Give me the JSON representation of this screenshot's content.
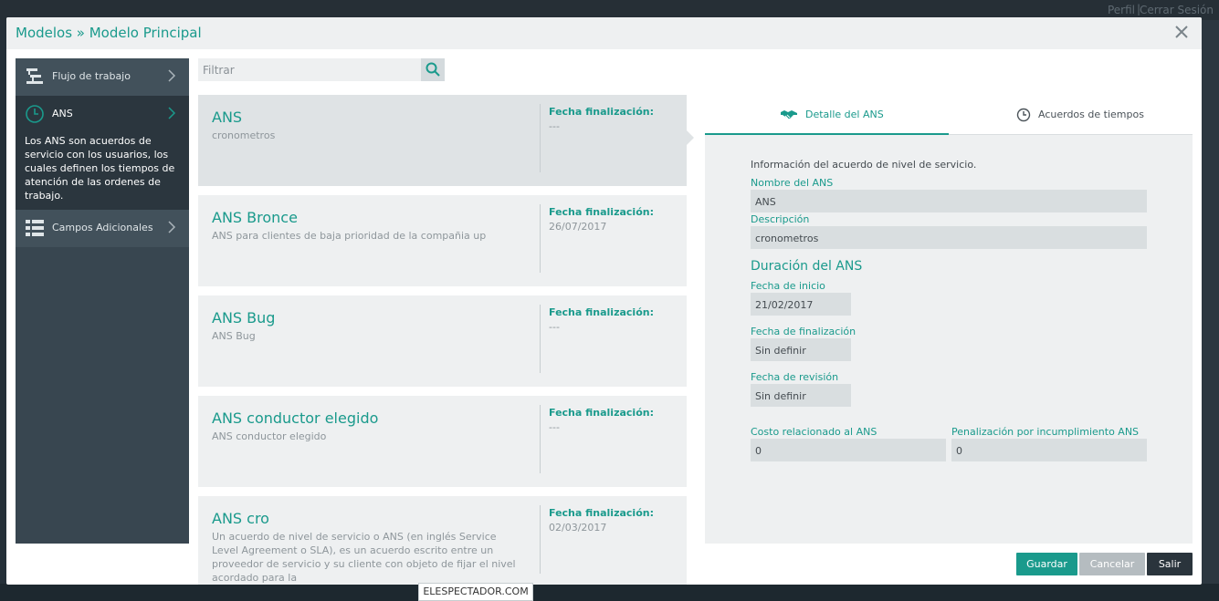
{
  "background": {
    "profile_label": "Perfil",
    "logout_label": "Cerrar Sesión"
  },
  "modal": {
    "title": "Modelos » Modelo Principal"
  },
  "sidebar": {
    "items": [
      {
        "label": "Flujo de trabajo",
        "icon": "workflow-icon"
      },
      {
        "label": "ANS",
        "icon": "clock-icon",
        "description": "Los ANS son acuerdos de servicio con los usuarios, los cuales definen los tiempos de atención de las ordenes de trabajo."
      },
      {
        "label": "Campos Adicionales",
        "icon": "list-icon"
      }
    ]
  },
  "filter": {
    "placeholder": "Filtrar"
  },
  "cards": [
    {
      "title": "ANS",
      "description": "cronometros",
      "date_label": "Fecha finalización:",
      "date": "---"
    },
    {
      "title": "ANS Bronce",
      "description": "ANS para clientes de baja prioridad de la compañia up",
      "date_label": "Fecha finalización:",
      "date": "26/07/2017"
    },
    {
      "title": "ANS Bug",
      "description": "ANS Bug",
      "date_label": "Fecha finalización:",
      "date": "---"
    },
    {
      "title": "ANS conductor elegido",
      "description": "ANS conductor elegido",
      "date_label": "Fecha finalización:",
      "date": "---"
    },
    {
      "title": "ANS cro",
      "description": "Un acuerdo de nivel de servicio o ANS (en inglés Service Level Agreement o SLA), es un acuerdo escrito entre un proveedor de servicio y su cliente con objeto de fijar el nivel acordado para la",
      "date_label": "Fecha finalización:",
      "date": "02/03/2017"
    }
  ],
  "detail": {
    "tabs": [
      {
        "label": "Detalle del ANS",
        "icon": "handshake-icon"
      },
      {
        "label": "Acuerdos de tiempos",
        "icon": "clock-icon"
      }
    ],
    "intro": "Información del acuerdo de nivel de servicio.",
    "name_label": "Nombre del ANS",
    "name_value": "ANS",
    "description_label": "Descripción",
    "description_value": "cronometros",
    "duration_title": "Duración del ANS",
    "start_label": "Fecha de inicio",
    "start_value": "21/02/2017",
    "end_label": "Fecha de finalización",
    "end_value": "Sin definir",
    "review_label": "Fecha de revisión",
    "review_value": "Sin definir",
    "cost_label": "Costo relacionado al ANS",
    "cost_value": "0",
    "penalty_label": "Penalización por incumplimiento ANS",
    "penalty_value": "0"
  },
  "footer": {
    "save_label": "Guardar",
    "cancel_label": "Cancelar",
    "exit_label": "Salir"
  },
  "watermark": "ELESPECTADOR.COM",
  "colors": {
    "accent": "#1a9a8c",
    "sidebar": "#384650",
    "panel": "#eef0f1"
  }
}
